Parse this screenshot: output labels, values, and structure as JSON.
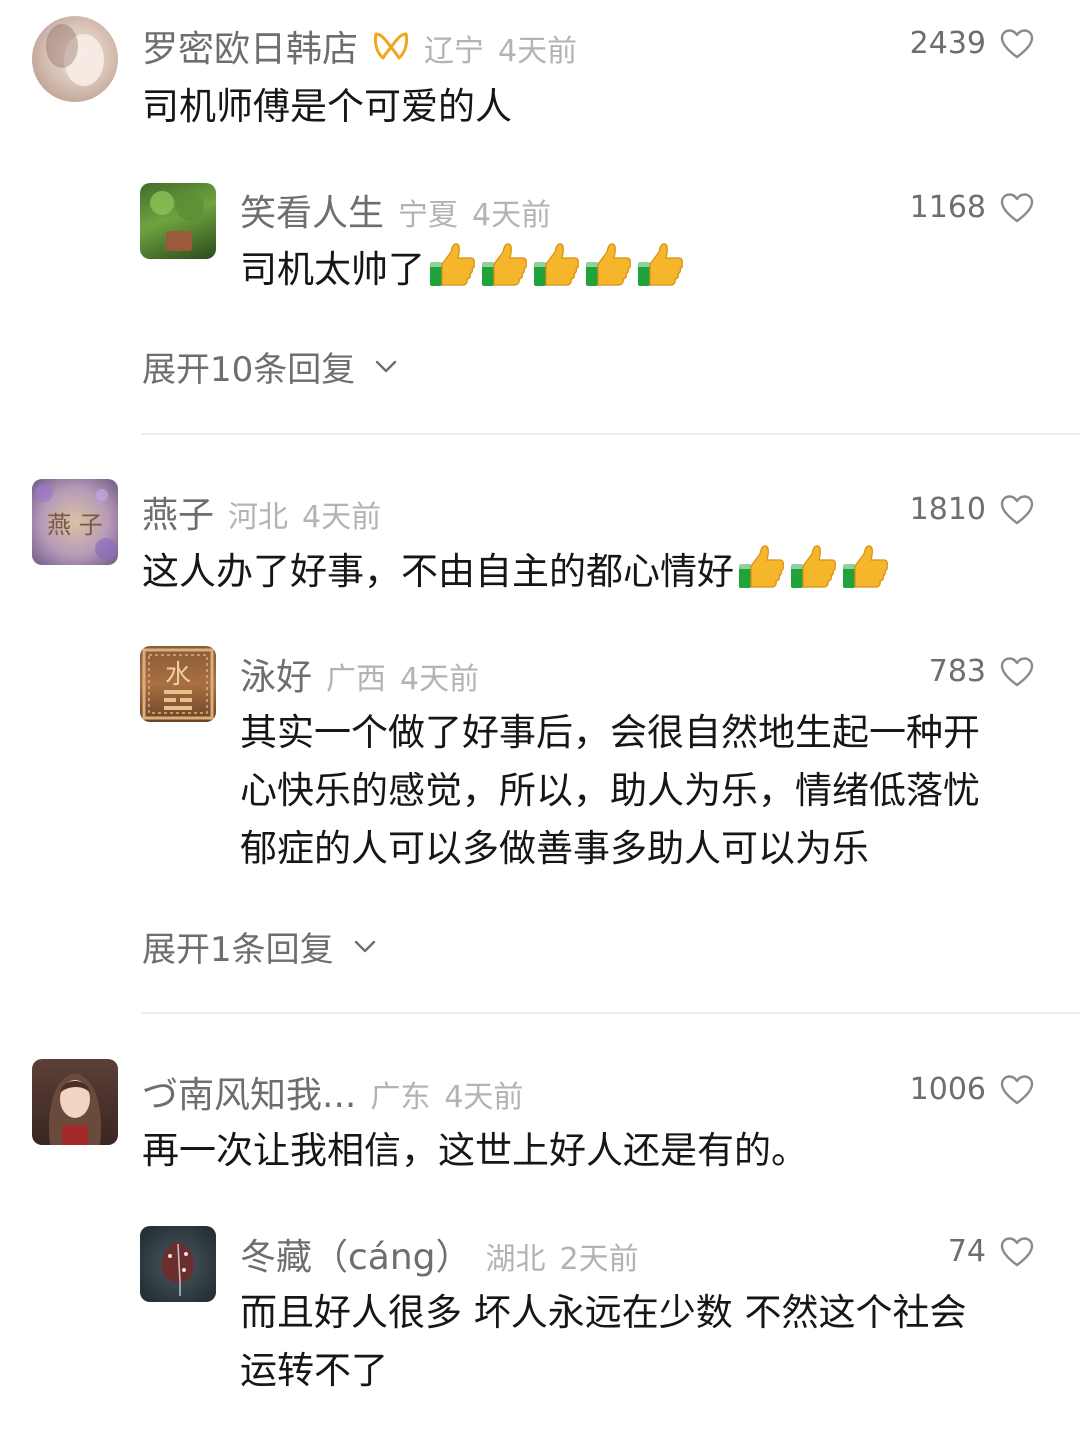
{
  "comments": [
    {
      "nick": "罗密欧日韩店",
      "region": "辽宁",
      "time": "4天前",
      "likes": "2439",
      "text": "司机师傅是个可爱的人",
      "reply": {
        "nick": "笑看人生",
        "region": "宁夏",
        "time": "4天前",
        "likes": "1168",
        "text": "司机太帅了"
      },
      "expand": "展开10条回复"
    },
    {
      "nick": "燕子",
      "region": "河北",
      "time": "4天前",
      "likes": "1810",
      "text": "这人办了好事，不由自主的都心情好",
      "avatar_text": "燕 子",
      "reply": {
        "nick": "泳好",
        "region": "广西",
        "time": "4天前",
        "likes": "783",
        "avatar_text": "水",
        "text_lines": [
          "其实一个做了好事后，会很自然地生起一种开",
          "心快乐的感觉，所以，助人为乐，情绪低落忧",
          "郁症的人可以多做善事多助人可以为乐"
        ]
      },
      "expand": "展开1条回复"
    },
    {
      "nick": "づ南风知我...",
      "region": "广东",
      "time": "4天前",
      "likes": "1006",
      "text": "再一次让我相信，这世上好人还是有的。",
      "reply": {
        "nick": "冬藏（cáng）",
        "region": "湖北",
        "time": "2天前",
        "likes": "74",
        "text_lines": [
          "而且好人很多 坏人永远在少数 不然这个社会",
          "运转不了"
        ]
      }
    }
  ],
  "colors": {
    "primary_text": "#161616",
    "secondary_text": "#6e6e6e",
    "muted_text": "#b3b3b3",
    "divider": "#ececec",
    "thumb_yellow": "#f6b62b",
    "cuff_green": "#1fa33a"
  },
  "icons": {
    "like": "heart-outline-icon",
    "expand": "chevron-down-icon",
    "badge": "ribbon-badge-icon",
    "emoji": "thumbs-up-emoji"
  }
}
